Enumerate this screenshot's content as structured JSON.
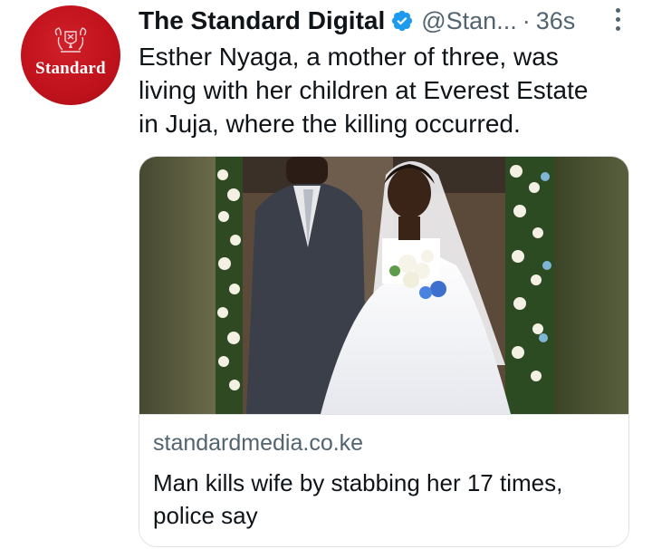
{
  "tweet": {
    "account": {
      "display_name": "The Standard Digital",
      "handle": "@Stan...",
      "separator": "·",
      "time": "36s",
      "avatar_text": "Standard",
      "verified_icon": "verified-badge-icon"
    },
    "text": "Esther Nyaga, a mother of three, was\nliving with her children at Everest Estate\nin Juja, where the killing occurred.",
    "link_card": {
      "image_description_icon": "wedding-photo",
      "domain": "standardmedia.co.ke",
      "title": "Man kills wife by stabbing her 17 times, police say"
    }
  },
  "colors": {
    "brand_red": "#c0121c",
    "verified_blue": "#1d9bf0",
    "secondary_text": "#536471",
    "primary_text": "#0f1419"
  }
}
